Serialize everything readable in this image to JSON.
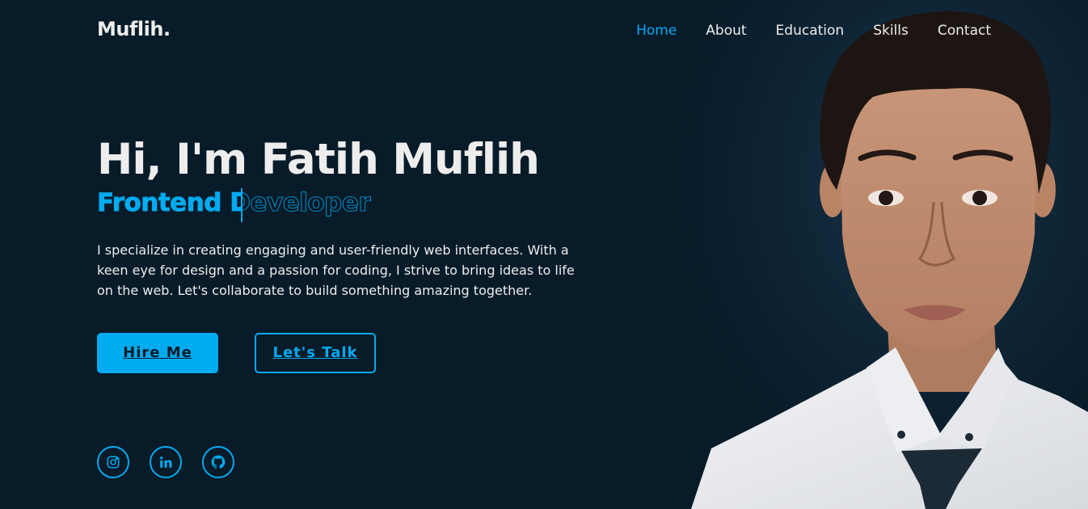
{
  "brand": {
    "logo": "Muflih."
  },
  "nav": {
    "items": [
      "Home",
      "About",
      "Education",
      "Skills",
      "Contact"
    ],
    "active": "Home"
  },
  "hero": {
    "title": "Hi, I'm Fatih Muflih",
    "subtitle": "Frontend Developer",
    "description": "I specialize in creating engaging and user-friendly web interfaces. With a keen eye for design and a passion for coding, I strive to bring ideas to life on the web. Let's collaborate to build something amazing together.",
    "primary_button": "Hire Me",
    "secondary_button": "Let's Talk"
  },
  "social": [
    {
      "icon": "instagram-icon"
    },
    {
      "icon": "linkedin-icon"
    },
    {
      "icon": "github-icon"
    }
  ],
  "colors": {
    "background": "#081b29",
    "accent": "#00abf0",
    "text": "#ededed"
  }
}
